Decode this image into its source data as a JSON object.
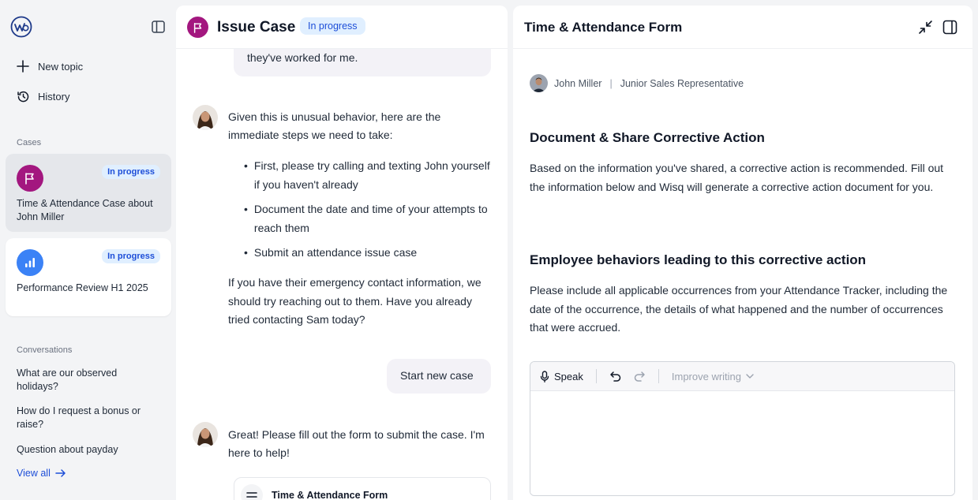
{
  "sidebar": {
    "new_topic": "New topic",
    "history": "History",
    "cases_label": "Cases",
    "cases": [
      {
        "badge": "In progress",
        "title": "Time & Attendance Case about John Miller",
        "icon": "flag-icon",
        "color": "#a3177f"
      },
      {
        "badge": "In progress",
        "title": "Performance Review H1 2025",
        "icon": "bar-chart-icon",
        "color": "#3b82f6"
      }
    ],
    "conversations_label": "Conversations",
    "conversations": [
      "What are our observed holidays?",
      "How do I request a bonus or raise?",
      "Question about payday"
    ],
    "view_all": "View all"
  },
  "chat": {
    "title": "Issue Case",
    "badge": "In progress",
    "user_bubble_1": "they've worked for me.",
    "bot_msg_1": "Given this is unusual behavior, here are the immediate steps we need to take:",
    "bot_list": [
      "First, please try calling and texting John yourself if you haven't already",
      "Document the date and time of your attempts to reach them",
      "Submit an attendance issue case"
    ],
    "bot_msg_2": "If you have their emergency contact information, we should try reaching out to them. Have you already tried contacting Sam today?",
    "user_bubble_2": "Start new case",
    "bot_msg_3": "Great! Please fill out the form to submit the case. I'm here to help!",
    "form_card_title": "Time & Attendance Form"
  },
  "form": {
    "title": "Time & Attendance Form",
    "person_name": "John Miller",
    "person_role": "Junior Sales Representative",
    "section1_title": "Document & Share Corrective Action",
    "section1_text": "Based on the information you've shared, a corrective action is recommended. Fill out the information below and Wisq will generate a corrective action document for you.",
    "section2_title": "Employee behaviors leading to this corrective action",
    "section2_text": "Please include all applicable occurrences from your Attendance Tracker, including the date of the occurrence, the details of what happened and the number of occurrences that were accrued.",
    "toolbar": {
      "speak": "Speak",
      "improve": "Improve writing"
    },
    "editor_value": ""
  },
  "colors": {
    "accent": "#1d4ed8",
    "badge_bg": "#e0efff",
    "case_flag": "#a3177f",
    "case_chart": "#3b82f6"
  }
}
